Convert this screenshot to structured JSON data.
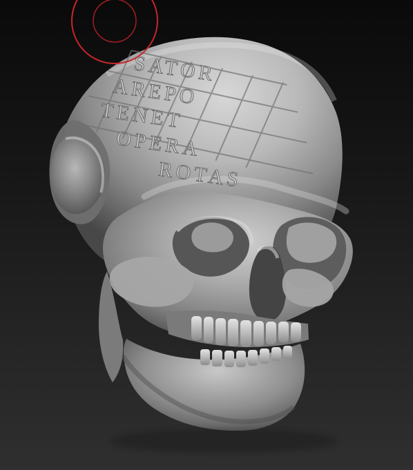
{
  "viewport": {
    "background_top": "#0a0a0a",
    "background_bottom": "#2f2f2f",
    "model": "skull-sculpt"
  },
  "brush": {
    "ring_color": "#c8262a",
    "icon": "brush-cursor-icon"
  },
  "inscription": {
    "row_1": "SATOR",
    "row_2": "AREPO",
    "row_3": "TENET",
    "row_4": "OPERA",
    "row_5": "ROTAS"
  }
}
